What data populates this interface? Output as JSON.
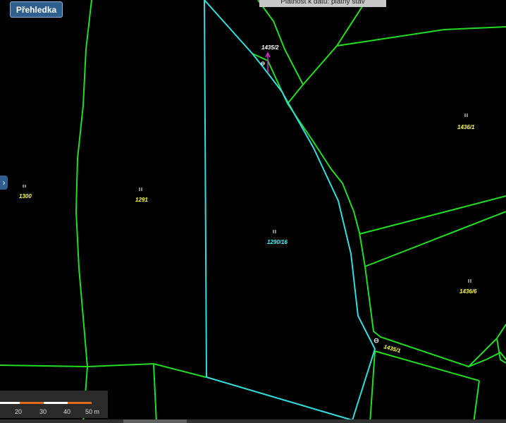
{
  "toolbar": {
    "overview_label": "Přehledka"
  },
  "banner": {
    "validity_text": "Platnost k datu: platný stav"
  },
  "scale_bar": {
    "ticks": [
      "20",
      "30",
      "40",
      "50 m"
    ]
  },
  "parcels": [
    {
      "id": "p1300",
      "number": "1300",
      "color": "#ffff33"
    },
    {
      "id": "p1291",
      "number": "1291",
      "color": "#ffff33"
    },
    {
      "id": "p1290_16",
      "number": "1290/16",
      "color": "#33ffff"
    },
    {
      "id": "p1436_1",
      "number": "1436/1",
      "color": "#ffff33"
    },
    {
      "id": "p1436_6",
      "number": "1436/6",
      "color": "#ffff33"
    },
    {
      "id": "p1435_1",
      "number": "1435/1",
      "color": "#ffff33"
    },
    {
      "id": "p1435_2",
      "number": "1435/2",
      "color": "#ffffff"
    }
  ],
  "colors": {
    "boundary_green": "#22dd22",
    "boundary_cyan": "#33dddd",
    "arrow_magenta": "#cc33cc",
    "background": "#000000",
    "scale_orange": "#e06a1a"
  },
  "icons": [
    "chevron-right-icon",
    "culture-symbol-icon",
    "theta-symbol-icon"
  ]
}
